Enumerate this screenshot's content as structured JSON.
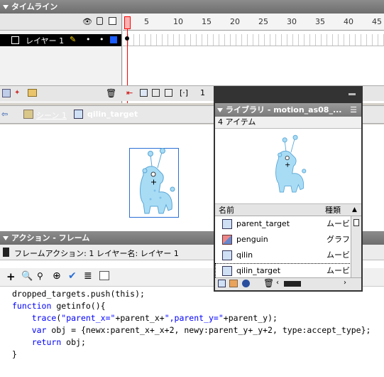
{
  "timeline": {
    "title": "タイムライン",
    "layer_name": "レイヤー 1",
    "ruler_ticks": [
      "1",
      "5",
      "10",
      "15",
      "20",
      "25",
      "30",
      "35",
      "40",
      "45"
    ],
    "current_frame": "1"
  },
  "stage": {
    "breadcrumb_scene": "シーン 1",
    "breadcrumb_symbol": "qilin_target"
  },
  "actions": {
    "title": "アクション - フレーム",
    "subtitle": "フレームアクション: 1 レイヤー名: レイヤー 1",
    "code_lines": [
      "dropped_targets.push(this);",
      "function getinfo(){",
      "    trace(\"parent_x=\"+parent_x+\",parent_y=\"+parent_y);",
      "    var obj = {newx:parent_x+_x+2, newy:parent_y+_y+2, type:accept_type};",
      "    return obj;",
      "}"
    ]
  },
  "library": {
    "title": "ライブラリ - motion_as08_...",
    "count": "4 アイテム",
    "col_name": "名前",
    "col_kind": "種類",
    "items": [
      {
        "name": "parent_target",
        "kind": "ムービ",
        "icon": "movieclip-icon"
      },
      {
        "name": "penguin",
        "kind": "グラフィ",
        "icon": "graphic-icon"
      },
      {
        "name": "qilin",
        "kind": "ムービ",
        "icon": "movieclip-icon"
      },
      {
        "name": "qilin_target",
        "kind": "ムービ",
        "icon": "movieclip-icon"
      }
    ]
  },
  "colors": {
    "panel_header": "#7a7a7a",
    "playhead": "#ff0000",
    "layer_selected": "#000000",
    "code_keyword": "#0000ff",
    "giraffe_fill": "#a8dcf5",
    "selection_border": "#2a6fd6"
  }
}
